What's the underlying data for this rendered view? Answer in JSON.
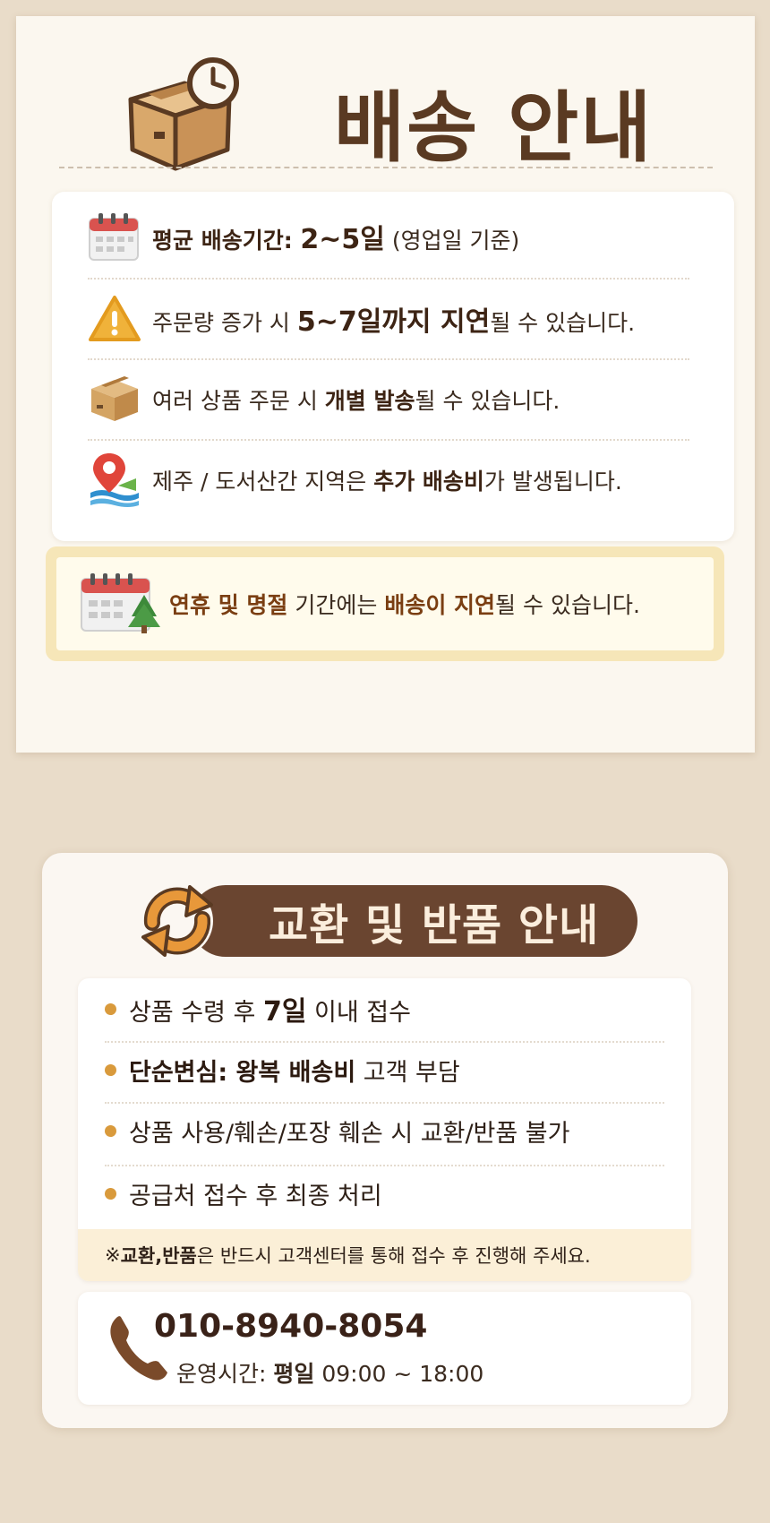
{
  "shipping": {
    "title": "배송 안내",
    "rows": [
      {
        "icon": "calendar-icon",
        "bold": "평균 배송기간: ",
        "bold_big": "2~5일",
        "rest": " (영업일 기준)"
      },
      {
        "icon": "warning-icon",
        "pre": "주문량 증가 시 ",
        "bold": "5~7일까지 지연",
        "rest": "될 수 있습니다."
      },
      {
        "icon": "package-icon",
        "pre": "여러 상품 주문 시 ",
        "bold": "개별 발송",
        "rest": "될 수 있습니다."
      },
      {
        "icon": "map-pin-icon",
        "pre": "제주 / 도서산간 지역은 ",
        "bold": "추가 배송비",
        "rest": "가 발생됩니다."
      }
    ],
    "holiday": {
      "icon": "holiday-calendar-icon",
      "bold1": "연휴 및 명절",
      "mid": " 기간에는 ",
      "bold2": "배송이 지연",
      "rest": "될 수 있습니다."
    }
  },
  "returns": {
    "title": "교환 및 반품 안내",
    "icon": "exchange-arrows-icon",
    "rows": [
      {
        "pre": "상품 수령 후 ",
        "bold": "7일",
        "rest": " 이내 접수"
      },
      {
        "pre": "",
        "bold": "단순변심: 왕복 배송비",
        "rest": " 고객 부담"
      },
      {
        "pre": "상품 사용/훼손/포장 훼손 시 교환/반품 불가",
        "bold": "",
        "rest": ""
      },
      {
        "pre": "공급처 접수 후 최종 처리",
        "bold": "",
        "rest": ""
      }
    ],
    "note": {
      "prefix": "※ ",
      "bold": "교환,반품",
      "rest": " 은 반드시 고객센터를 통해 접수 후 진행해 주세요."
    },
    "contact": {
      "icon": "phone-icon",
      "number": "010-8940-8054",
      "hours_label": "운영시간: ",
      "hours_day": "평일",
      "hours_time": " 09:00 ~ 18:00"
    }
  }
}
